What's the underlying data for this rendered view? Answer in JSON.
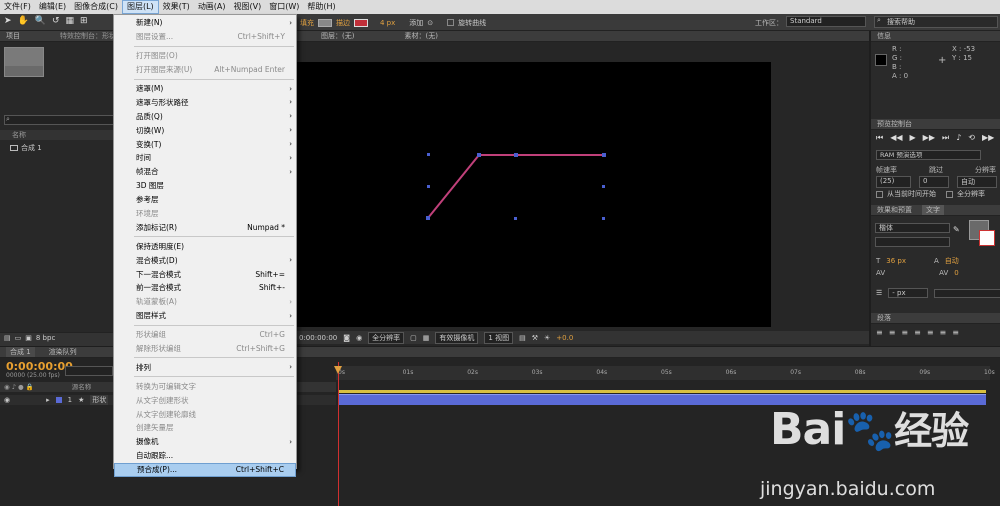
{
  "menubar": [
    "文件(F)",
    "编辑(E)",
    "图像合成(C)",
    "图层(L)",
    "效果(T)",
    "动画(A)",
    "视图(V)",
    "窗口(W)",
    "帮助(H)"
  ],
  "toolbar": {
    "fill": "填充",
    "stroke": "描边",
    "stroke_px": "4 px",
    "add": "添加",
    "rotobezier": "旋转曲线",
    "workspace_label": "工作区：",
    "workspace": "Standard",
    "search_help": "搜索帮助"
  },
  "left_panel": {
    "project_tab": "项目",
    "effects_tab": "特效控制台：形状",
    "col_name": "名称",
    "item": "合成 1",
    "bpc": "8 bpc"
  },
  "comp_header": {
    "layer": "图层：(无)",
    "footage": "素材：(无)"
  },
  "viewer_bar": {
    "time": "0:00:00:00",
    "res": "全分辨率",
    "camera": "有效摄像机",
    "views": "1 视图",
    "exposure": "+0.0"
  },
  "info": {
    "title": "信息",
    "r": "R :",
    "g": "G :",
    "b": "B :",
    "a": "A : 0",
    "x": "X : -53",
    "y": "Y : 15"
  },
  "preview": {
    "title": "预览控制台",
    "ram": "RAM 预演选项",
    "fps_label": "帧速率",
    "skip_label": "跳过",
    "res_label": "分辨率",
    "fps": "(25)",
    "skip": "0",
    "res": "自动",
    "from_current": "从当前时间开始",
    "full_screen": "全分辨率"
  },
  "effects_text": {
    "tab1": "效果和预置",
    "tab2": "文字",
    "font": "楷体",
    "size": "36 px",
    "leading": "自动",
    "tracking": "0",
    "tsz": "- px"
  },
  "paragraph": {
    "title": "段落"
  },
  "timeline": {
    "tab_comp": "合成 1",
    "tab_render": "渲染队列",
    "timecode": "0:00:00:00",
    "fps_info": "00000 (25.00 fps)",
    "layer_num": "1",
    "layer_name": "形状",
    "col_source": "源名称",
    "ruler": [
      "0s",
      "01s",
      "02s",
      "03s",
      "04s",
      "05s",
      "06s",
      "07s",
      "08s",
      "09s",
      "10s"
    ]
  },
  "menu": [
    {
      "t": "新建(N)",
      "a": true
    },
    {
      "t": "图层设置...",
      "s": "Ctrl+Shift+Y",
      "d": true
    },
    "-",
    {
      "t": "打开图层(O)",
      "d": true
    },
    {
      "t": "打开图层来源(U)",
      "s": "Alt+Numpad Enter",
      "d": true
    },
    "-",
    {
      "t": "遮罩(M)",
      "a": true
    },
    {
      "t": "遮罩与形状路径",
      "a": true
    },
    {
      "t": "品质(Q)",
      "a": true
    },
    {
      "t": "切换(W)",
      "a": true
    },
    {
      "t": "变换(T)",
      "a": true
    },
    {
      "t": "时间",
      "a": true
    },
    {
      "t": "帧混合",
      "a": true
    },
    {
      "t": "3D 图层"
    },
    {
      "t": "参考层"
    },
    {
      "t": "环境层",
      "d": true
    },
    {
      "t": "添加标记(R)",
      "s": "Numpad *"
    },
    "-",
    {
      "t": "保持透明度(E)"
    },
    {
      "t": "混合模式(D)",
      "a": true
    },
    {
      "t": "下一混合模式",
      "s": "Shift+="
    },
    {
      "t": "前一混合模式",
      "s": "Shift+-"
    },
    {
      "t": "轨道蒙板(A)",
      "a": true,
      "d": true
    },
    {
      "t": "图层样式",
      "a": true
    },
    "-",
    {
      "t": "形状编组",
      "s": "Ctrl+G",
      "d": true
    },
    {
      "t": "解除形状编组",
      "s": "Ctrl+Shift+G",
      "d": true
    },
    "-",
    {
      "t": "排列",
      "a": true
    },
    "-",
    {
      "t": "转换为可编辑文字",
      "d": true
    },
    {
      "t": "从文字创建形状",
      "d": true
    },
    {
      "t": "从文字创建轮廓线",
      "d": true
    },
    {
      "t": "创建矢量层",
      "d": true
    },
    {
      "t": "摄像机",
      "a": true
    },
    {
      "t": "自动跟踪...",
      "d": false
    },
    {
      "t": "预合成(P)...",
      "s": "Ctrl+Shift+C",
      "h": true
    }
  ],
  "watermark": {
    "brand": "Bai",
    "brand2": "经验",
    "url": "jingyan.baidu.com"
  },
  "colors": {
    "accent": "#f0a030",
    "menu_hl": "#a9cdef",
    "shape_line": "#c0407a",
    "handle": "#4a5fd0",
    "timebar": "#5a6ad6"
  }
}
